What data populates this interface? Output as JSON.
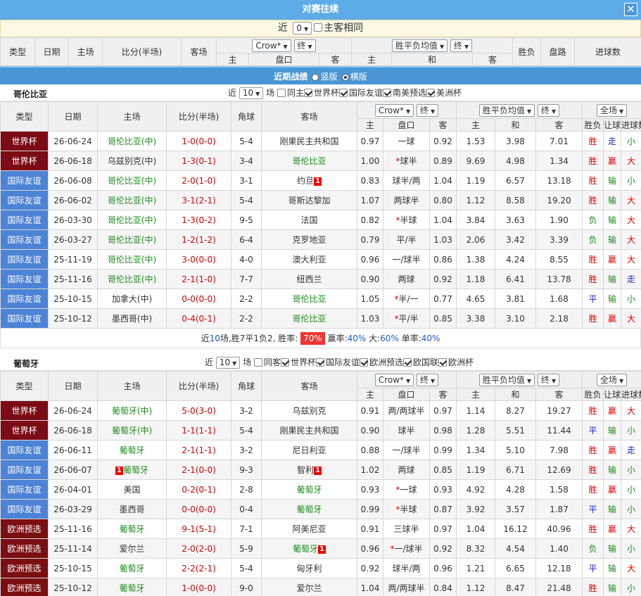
{
  "title": "对赛往续",
  "close_label": "✕",
  "filter1": {
    "pre": "近",
    "select": "0",
    "post": "场",
    "same": "主客相同"
  },
  "top_header": {
    "type": "类型",
    "date": "日期",
    "home": "主场",
    "score": "比分(半场)",
    "away": "客场",
    "company": "Crow*",
    "end": "终",
    "odds_type": "胜平负均值",
    "end2": "终",
    "result": "胜负",
    "handicap_res": "盘路",
    "goals": "进球数",
    "sub": [
      "主",
      "盘口",
      "客",
      "主",
      "和",
      "客"
    ]
  },
  "recent": {
    "label": "近期战绩",
    "opt1": "竖版",
    "opt2": "横版"
  },
  "team1": {
    "name": "哥伦比亚",
    "filter": {
      "pre": "近",
      "select": "10",
      "post": "场",
      "same": "同主",
      "leagues": [
        "世界杯",
        "国际友谊",
        "南美预选",
        "美洲杯"
      ]
    },
    "header": {
      "type": "类型",
      "date": "日期",
      "home": "主场",
      "score": "比分(半场)",
      "corner": "角球",
      "away": "客场",
      "company": "Crow*",
      "end": "终",
      "odds_type": "胜平负均值",
      "end2": "终",
      "scope": "全场",
      "result": "胜负",
      "handicap_res": "让球",
      "goals": "进球数",
      "sub": [
        "主",
        "盘口",
        "客",
        "主",
        "和",
        "客"
      ]
    },
    "rows": [
      {
        "league": "世界杯",
        "lc": "wc",
        "date": "26-06-24",
        "home": "哥伦比亚(中)",
        "hg": true,
        "hcard": "",
        "score": "1-0(0-0)",
        "sc": "r",
        "corner": "5-4",
        "away": "刚果民主共和国",
        "ag": false,
        "acard": "",
        "h1": "0.97",
        "line": "一球",
        "a1": "0.92",
        "oh": "1.53",
        "od": "3.98",
        "oa": "7.01",
        "res": "胜",
        "rc": "r",
        "hres": "走",
        "hc": "b",
        "goals": "小",
        "gc": "g"
      },
      {
        "league": "世界杯",
        "lc": "wc",
        "date": "26-06-18",
        "home": "乌兹别克(中)",
        "hg": false,
        "hcard": "",
        "score": "1-3(0-1)",
        "sc": "r",
        "corner": "3-4",
        "away": "哥伦比亚",
        "ag": true,
        "acard": "",
        "h1": "1.00",
        "line": "*球半",
        "a1": "0.89",
        "oh": "9.69",
        "od": "4.98",
        "oa": "1.34",
        "res": "胜",
        "rc": "r",
        "hres": "赢",
        "hc": "r",
        "goals": "大",
        "gc": "r"
      },
      {
        "league": "国际友谊",
        "lc": "fr",
        "date": "26-06-08",
        "home": "哥伦比亚(中)",
        "hg": true,
        "hcard": "",
        "score": "2-0(1-0)",
        "sc": "r",
        "corner": "3-1",
        "away": "约旦",
        "ag": false,
        "acard": "1",
        "h1": "0.83",
        "line": "球半/两",
        "a1": "1.04",
        "oh": "1.19",
        "od": "6.57",
        "oa": "13.18",
        "res": "胜",
        "rc": "r",
        "hres": "输",
        "hc": "g",
        "goals": "小",
        "gc": "g"
      },
      {
        "league": "国际友谊",
        "lc": "fr",
        "date": "26-06-02",
        "home": "哥伦比亚(中)",
        "hg": true,
        "hcard": "",
        "score": "3-1(2-1)",
        "sc": "r",
        "corner": "5-4",
        "away": "哥斯达黎加",
        "ag": false,
        "acard": "",
        "h1": "1.07",
        "line": "两球半",
        "a1": "0.80",
        "oh": "1.12",
        "od": "8.58",
        "oa": "19.20",
        "res": "胜",
        "rc": "r",
        "hres": "输",
        "hc": "g",
        "goals": "大",
        "gc": "r"
      },
      {
        "league": "国际友谊",
        "lc": "fr",
        "date": "26-03-30",
        "home": "哥伦比亚(中)",
        "hg": true,
        "hcard": "",
        "score": "1-3(0-2)",
        "sc": "r",
        "corner": "9-5",
        "away": "法国",
        "ag": false,
        "acard": "",
        "h1": "0.82",
        "line": "*半球",
        "a1": "1.04",
        "oh": "3.84",
        "od": "3.63",
        "oa": "1.90",
        "res": "负",
        "rc": "g",
        "hres": "输",
        "hc": "g",
        "goals": "大",
        "gc": "r"
      },
      {
        "league": "国际友谊",
        "lc": "fr",
        "date": "26-03-27",
        "home": "哥伦比亚(中)",
        "hg": true,
        "hcard": "",
        "score": "1-2(1-2)",
        "sc": "r",
        "corner": "6-4",
        "away": "克罗地亚",
        "ag": false,
        "acard": "",
        "h1": "0.79",
        "line": "平/半",
        "a1": "1.03",
        "oh": "2.06",
        "od": "3.42",
        "oa": "3.39",
        "res": "负",
        "rc": "g",
        "hres": "输",
        "hc": "g",
        "goals": "大",
        "gc": "r"
      },
      {
        "league": "国际友谊",
        "lc": "fr",
        "date": "25-11-19",
        "home": "哥伦比亚(中)",
        "hg": true,
        "hcard": "",
        "score": "3-0(0-0)",
        "sc": "r",
        "corner": "4-0",
        "away": "澳大利亚",
        "ag": false,
        "acard": "",
        "h1": "0.96",
        "line": "一/球半",
        "a1": "0.86",
        "oh": "1.38",
        "od": "4.24",
        "oa": "8.55",
        "res": "胜",
        "rc": "r",
        "hres": "赢",
        "hc": "r",
        "goals": "大",
        "gc": "r"
      },
      {
        "league": "国际友谊",
        "lc": "fr",
        "date": "25-11-16",
        "home": "哥伦比亚(中)",
        "hg": true,
        "hcard": "",
        "score": "2-1(1-0)",
        "sc": "r",
        "corner": "7-7",
        "away": "纽西兰",
        "ag": false,
        "acard": "",
        "h1": "0.90",
        "line": "两球",
        "a1": "0.92",
        "oh": "1.18",
        "od": "6.41",
        "oa": "13.78",
        "res": "胜",
        "rc": "r",
        "hres": "输",
        "hc": "g",
        "goals": "走",
        "gc": "b"
      },
      {
        "league": "国际友谊",
        "lc": "fr",
        "date": "25-10-15",
        "home": "加拿大(中)",
        "hg": false,
        "hcard": "",
        "score": "0-0(0-0)",
        "sc": "r",
        "corner": "2-2",
        "away": "哥伦比亚",
        "ag": true,
        "acard": "",
        "h1": "1.05",
        "line": "*半/一",
        "a1": "0.77",
        "oh": "4.65",
        "od": "3.81",
        "oa": "1.68",
        "res": "平",
        "rc": "b",
        "hres": "输",
        "hc": "g",
        "goals": "小",
        "gc": "g"
      },
      {
        "league": "国际友谊",
        "lc": "fr",
        "date": "25-10-12",
        "home": "墨西哥(中)",
        "hg": false,
        "hcard": "",
        "score": "0-4(0-1)",
        "sc": "r",
        "corner": "2-2",
        "away": "哥伦比亚",
        "ag": true,
        "acard": "",
        "h1": "1.03",
        "line": "*平/半",
        "a1": "0.85",
        "oh": "3.38",
        "od": "3.10",
        "oa": "2.18",
        "res": "胜",
        "rc": "r",
        "hres": "赢",
        "hc": "r",
        "goals": "大",
        "gc": "r"
      }
    ],
    "summary": {
      "a": "近",
      "n": "10",
      "b": "场,胜7平1负2, 胜率:",
      "pct": "70%",
      "c": "赢率:",
      "win": "40%",
      "d": "大:",
      "big": "60%",
      "e": "单率:",
      "odd": "40%"
    }
  },
  "team2": {
    "name": "葡萄牙",
    "filter": {
      "pre": "近",
      "select": "10",
      "post": "场",
      "same": "同客",
      "leagues": [
        "世界杯",
        "国际友谊",
        "欧洲预选",
        "欧国联",
        "欧洲杯"
      ]
    },
    "header": {
      "type": "类型",
      "date": "日期",
      "home": "主场",
      "score": "比分(半场)",
      "corner": "角球",
      "away": "客场",
      "company": "Crow*",
      "end": "终",
      "odds_type": "胜平负均值",
      "end2": "终",
      "scope": "全场",
      "result": "胜负",
      "handicap_res": "让球",
      "goals": "进球数",
      "sub": [
        "主",
        "盘口",
        "客",
        "主",
        "和",
        "客"
      ]
    },
    "rows": [
      {
        "league": "世界杯",
        "lc": "wc",
        "date": "26-06-24",
        "home": "葡萄牙(中)",
        "hg": true,
        "hcard": "",
        "score": "5-0(3-0)",
        "sc": "r",
        "corner": "3-2",
        "away": "乌兹别克",
        "ag": false,
        "acard": "",
        "h1": "0.91",
        "line": "两/两球半",
        "a1": "0.97",
        "oh": "1.14",
        "od": "8.27",
        "oa": "19.27",
        "res": "胜",
        "rc": "r",
        "hres": "赢",
        "hc": "r",
        "goals": "大",
        "gc": "r"
      },
      {
        "league": "世界杯",
        "lc": "wc",
        "date": "26-06-18",
        "home": "葡萄牙(中)",
        "hg": true,
        "hcard": "",
        "score": "1-1(1-1)",
        "sc": "r",
        "corner": "5-4",
        "away": "刚果民主共和国",
        "ag": false,
        "acard": "",
        "h1": "0.90",
        "line": "球半",
        "a1": "0.98",
        "oh": "1.28",
        "od": "5.51",
        "oa": "11.44",
        "res": "平",
        "rc": "b",
        "hres": "输",
        "hc": "g",
        "goals": "小",
        "gc": "g"
      },
      {
        "league": "国际友谊",
        "lc": "fr",
        "date": "26-06-11",
        "home": "葡萄牙",
        "hg": true,
        "hcard": "",
        "score": "2-1(1-1)",
        "sc": "r",
        "corner": "3-2",
        "away": "尼日利亚",
        "ag": false,
        "acard": "",
        "h1": "0.88",
        "line": "一/球半",
        "a1": "0.99",
        "oh": "1.34",
        "od": "5.10",
        "oa": "7.98",
        "res": "胜",
        "rc": "r",
        "hres": "赢",
        "hc": "r",
        "goals": "走",
        "gc": "b"
      },
      {
        "league": "国际友谊",
        "lc": "fr",
        "date": "26-06-07",
        "home": "葡萄牙",
        "hg": true,
        "hcard": "1",
        "score": "2-1(0-0)",
        "sc": "r",
        "corner": "9-3",
        "away": "智利",
        "ag": false,
        "acard": "1",
        "h1": "1.02",
        "line": "两球",
        "a1": "0.85",
        "oh": "1.19",
        "od": "6.71",
        "oa": "12.69",
        "res": "胜",
        "rc": "r",
        "hres": "输",
        "hc": "g",
        "goals": "小",
        "gc": "g"
      },
      {
        "league": "国际友谊",
        "lc": "fr",
        "date": "26-04-01",
        "home": "美国",
        "hg": false,
        "hcard": "",
        "score": "0-2(0-1)",
        "sc": "r",
        "corner": "2-8",
        "away": "葡萄牙",
        "ag": true,
        "acard": "",
        "h1": "0.93",
        "line": "*一球",
        "a1": "0.93",
        "oh": "4.92",
        "od": "4.28",
        "oa": "1.58",
        "res": "胜",
        "rc": "r",
        "hres": "赢",
        "hc": "r",
        "goals": "小",
        "gc": "g"
      },
      {
        "league": "国际友谊",
        "lc": "fr",
        "date": "26-03-29",
        "home": "墨西哥",
        "hg": false,
        "hcard": "",
        "score": "0-0(0-0)",
        "sc": "r",
        "corner": "0-4",
        "away": "葡萄牙",
        "ag": true,
        "acard": "",
        "h1": "0.99",
        "line": "*半球",
        "a1": "0.87",
        "oh": "3.92",
        "od": "3.57",
        "oa": "1.87",
        "res": "平",
        "rc": "b",
        "hres": "输",
        "hc": "g",
        "goals": "小",
        "gc": "g"
      },
      {
        "league": "欧洲预选",
        "lc": "eu",
        "date": "25-11-16",
        "home": "葡萄牙",
        "hg": true,
        "hcard": "",
        "score": "9-1(5-1)",
        "sc": "r",
        "corner": "7-1",
        "away": "阿美尼亚",
        "ag": false,
        "acard": "",
        "h1": "0.91",
        "line": "三球半",
        "a1": "0.97",
        "oh": "1.04",
        "od": "16.12",
        "oa": "40.96",
        "res": "胜",
        "rc": "r",
        "hres": "赢",
        "hc": "r",
        "goals": "大",
        "gc": "r"
      },
      {
        "league": "欧洲预选",
        "lc": "eu",
        "date": "25-11-14",
        "home": "爱尔兰",
        "hg": false,
        "hcard": "",
        "score": "2-0(2-0)",
        "sc": "r",
        "corner": "5-9",
        "away": "葡萄牙",
        "ag": true,
        "acard": "1",
        "h1": "0.96",
        "line": "*一/球半",
        "a1": "0.92",
        "oh": "8.32",
        "od": "4.54",
        "oa": "1.40",
        "res": "负",
        "rc": "g",
        "hres": "输",
        "hc": "g",
        "goals": "小",
        "gc": "g"
      },
      {
        "league": "欧洲预选",
        "lc": "eu",
        "date": "25-10-15",
        "home": "葡萄牙",
        "hg": true,
        "hcard": "",
        "score": "2-2(2-1)",
        "sc": "r",
        "corner": "5-4",
        "away": "匈牙利",
        "ag": false,
        "acard": "",
        "h1": "0.92",
        "line": "球半/两",
        "a1": "0.96",
        "oh": "1.21",
        "od": "6.65",
        "oa": "12.18",
        "res": "平",
        "rc": "b",
        "hres": "输",
        "hc": "g",
        "goals": "大",
        "gc": "r"
      },
      {
        "league": "欧洲预选",
        "lc": "eu",
        "date": "25-10-12",
        "home": "葡萄牙",
        "hg": true,
        "hcard": "",
        "score": "1-0(0-0)",
        "sc": "r",
        "corner": "9-0",
        "away": "爱尔兰",
        "ag": false,
        "acard": "",
        "h1": "1.04",
        "line": "两/两球半",
        "a1": "0.84",
        "oh": "1.12",
        "od": "8.47",
        "oa": "21.48",
        "res": "胜",
        "rc": "r",
        "hres": "输",
        "hc": "g",
        "goals": "小",
        "gc": "g"
      }
    ]
  },
  "colors": {
    "title_bar": "#5dace8",
    "section_bar": "#4a95d6",
    "world_cup": "#7b0b14",
    "friendly": "#4d83d6",
    "euro_qual": "#7a0e10",
    "win_red": "#dd0000",
    "lose_green": "#1c8c1c",
    "draw_blue": "#1a2ccc"
  }
}
